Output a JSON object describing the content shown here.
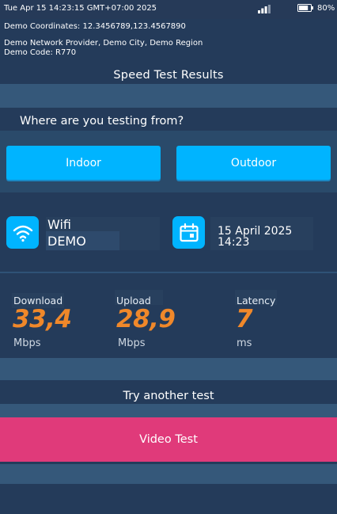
{
  "status_bar": {
    "datetime": "Tue Apr 15 14:23:15 GMT+07:00 2025",
    "battery_percent": "80%",
    "battery_level": 0.8
  },
  "header": {
    "coordinates": "Demo Coordinates: 12.3456789,123.4567890",
    "provider_line1": "Demo Network Provider, Demo City, Demo Region",
    "provider_line2": "Demo Code: R770"
  },
  "results": {
    "title": "Speed Test Results"
  },
  "location": {
    "question": "Where are you testing from?",
    "options": [
      "Indoor",
      "Outdoor"
    ]
  },
  "connection": {
    "type": "Wifi",
    "name": "DEMO",
    "date": "15 April 2025",
    "time": "14:23"
  },
  "stats": [
    {
      "label": "Download",
      "value": "33,4",
      "unit": "Mbps"
    },
    {
      "label": "Upload",
      "value": "28,9",
      "unit": "Mbps"
    },
    {
      "label": "Latency",
      "value": "7",
      "unit": "ms"
    }
  ],
  "another_test": {
    "title": "Try another test",
    "button": "Video Test"
  },
  "colors": {
    "background": "#243b5a",
    "accent_blue": "#00b4ff",
    "stat_orange": "#f0882a",
    "video_pink": "#e03a7a"
  },
  "icons": [
    "signal-icon",
    "battery-icon",
    "wifi-icon",
    "calendar-icon"
  ]
}
